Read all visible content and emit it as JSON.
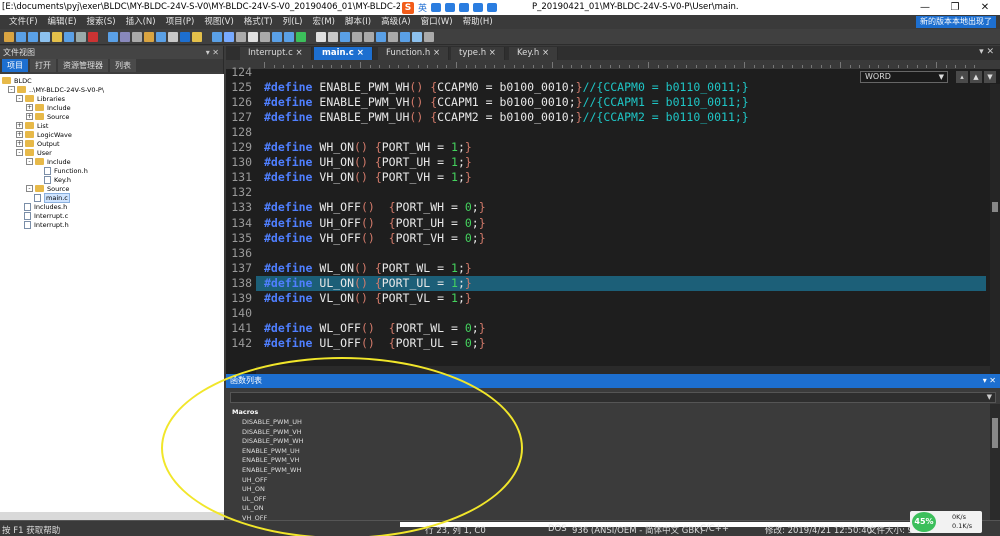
{
  "window": {
    "title": "[E:\\documents\\pyj\\exer\\BLDC\\MY-BLDC-24V-S-V0\\MY-BLDC-24V-S-V0_20190406_01\\MY-BLDC-24V-S",
    "title_tail": "P_20190421_01\\MY-BLDC-24V-S-V0-P\\User\\main.",
    "ime_label": "英",
    "minimize": "—",
    "maximize": "❐",
    "close": "✕"
  },
  "menu": {
    "items": [
      "文件(F)",
      "编辑(E)",
      "搜索(S)",
      "插入(N)",
      "项目(P)",
      "视图(V)",
      "格式(T)",
      "列(L)",
      "宏(M)",
      "脚本(I)",
      "高级(A)",
      "窗口(W)",
      "帮助(H)"
    ],
    "update_label": "新的版本本地出现了"
  },
  "left_panel": {
    "title": "文件视图",
    "controls": "▾ ✕",
    "tabs": [
      "项目",
      "打开",
      "资源管理器",
      "列表"
    ],
    "tree": {
      "root": "BLDC",
      "project": "..\\MY-BLDC-24V-S-V0-P\\",
      "nodes": [
        "Libraries",
        "Include",
        "Source",
        "List",
        "LogicWave",
        "Output",
        "User",
        "Include",
        "Function.h",
        "Key.h",
        "Source",
        "main.c",
        "Includes.h",
        "Interrupt.c",
        "Interrupt.h"
      ]
    }
  },
  "editor": {
    "tabs": [
      {
        "label": "Interrupt.c",
        "close": "×"
      },
      {
        "label": "main.c",
        "close": "×"
      },
      {
        "label": "Function.h",
        "close": "×"
      },
      {
        "label": "type.h",
        "close": "×"
      },
      {
        "label": "Key.h",
        "close": "×"
      }
    ],
    "tab_controls": "▾ ✕",
    "search_mode": "WORD",
    "search_buttons": [
      "▴",
      "▲",
      "▼"
    ],
    "line_numbers": [
      "124",
      "125",
      "126",
      "127",
      "128",
      "129",
      "130",
      "131",
      "132",
      "133",
      "134",
      "135",
      "136",
      "137",
      "138",
      "139",
      "140",
      "141",
      "142"
    ],
    "lines": [
      {
        "parts": []
      },
      {
        "parts": [
          [
            "kw",
            "#define"
          ],
          [
            "",
            " ENABLE_PWM_WH"
          ],
          [
            "br",
            "()"
          ],
          [
            "",
            " "
          ],
          [
            "br",
            "{"
          ],
          [
            "",
            "CCAPM0 = b0100_0010;"
          ],
          [
            "br",
            "}"
          ],
          [
            "cmt",
            "//{CCAPM0 = b0110_0011;}"
          ]
        ]
      },
      {
        "parts": [
          [
            "kw",
            "#define"
          ],
          [
            "",
            " ENABLE_PWM_VH"
          ],
          [
            "br",
            "()"
          ],
          [
            "",
            " "
          ],
          [
            "br",
            "{"
          ],
          [
            "",
            "CCAPM1 = b0100_0010;"
          ],
          [
            "br",
            "}"
          ],
          [
            "cmt",
            "//{CCAPM1 = b0110_0011;}"
          ]
        ]
      },
      {
        "parts": [
          [
            "kw",
            "#define"
          ],
          [
            "",
            " ENABLE_PWM_UH"
          ],
          [
            "br",
            "()"
          ],
          [
            "",
            " "
          ],
          [
            "br",
            "{"
          ],
          [
            "",
            "CCAPM2 = b0100_0010;"
          ],
          [
            "br",
            "}"
          ],
          [
            "cmt",
            "//{CCAPM2 = b0110_0011;}"
          ]
        ]
      },
      {
        "parts": []
      },
      {
        "parts": [
          [
            "kw",
            "#define"
          ],
          [
            "",
            " WH_ON"
          ],
          [
            "br",
            "()"
          ],
          [
            "",
            " "
          ],
          [
            "br",
            "{"
          ],
          [
            "",
            "PORT_WH = "
          ],
          [
            "num",
            "1"
          ],
          [
            "",
            ";"
          ],
          [
            "br",
            "}"
          ]
        ]
      },
      {
        "parts": [
          [
            "kw",
            "#define"
          ],
          [
            "",
            " UH_ON"
          ],
          [
            "br",
            "()"
          ],
          [
            "",
            " "
          ],
          [
            "br",
            "{"
          ],
          [
            "",
            "PORT_UH = "
          ],
          [
            "num",
            "1"
          ],
          [
            "",
            ";"
          ],
          [
            "br",
            "}"
          ]
        ]
      },
      {
        "parts": [
          [
            "kw",
            "#define"
          ],
          [
            "",
            " VH_ON"
          ],
          [
            "br",
            "()"
          ],
          [
            "",
            " "
          ],
          [
            "br",
            "{"
          ],
          [
            "",
            "PORT_VH = "
          ],
          [
            "num",
            "1"
          ],
          [
            "",
            ";"
          ],
          [
            "br",
            "}"
          ]
        ]
      },
      {
        "parts": []
      },
      {
        "parts": [
          [
            "kw",
            "#define"
          ],
          [
            "",
            " WH_OFF"
          ],
          [
            "br",
            "()"
          ],
          [
            "",
            "  "
          ],
          [
            "br",
            "{"
          ],
          [
            "",
            "PORT_WH = "
          ],
          [
            "num",
            "0"
          ],
          [
            "",
            ";"
          ],
          [
            "br",
            "}"
          ]
        ]
      },
      {
        "parts": [
          [
            "kw",
            "#define"
          ],
          [
            "",
            " UH_OFF"
          ],
          [
            "br",
            "()"
          ],
          [
            "",
            "  "
          ],
          [
            "br",
            "{"
          ],
          [
            "",
            "PORT_UH = "
          ],
          [
            "num",
            "0"
          ],
          [
            "",
            ";"
          ],
          [
            "br",
            "}"
          ]
        ]
      },
      {
        "parts": [
          [
            "kw",
            "#define"
          ],
          [
            "",
            " VH_OFF"
          ],
          [
            "br",
            "()"
          ],
          [
            "",
            "  "
          ],
          [
            "br",
            "{"
          ],
          [
            "",
            "PORT_VH = "
          ],
          [
            "num",
            "0"
          ],
          [
            "",
            ";"
          ],
          [
            "br",
            "}"
          ]
        ]
      },
      {
        "parts": []
      },
      {
        "parts": [
          [
            "kw",
            "#define"
          ],
          [
            "",
            " WL_ON"
          ],
          [
            "br",
            "()"
          ],
          [
            "",
            " "
          ],
          [
            "br",
            "{"
          ],
          [
            "",
            "PORT_WL = "
          ],
          [
            "num",
            "1"
          ],
          [
            "",
            ";"
          ],
          [
            "br",
            "}"
          ]
        ]
      },
      {
        "parts": [
          [
            "kw",
            "#define"
          ],
          [
            "",
            " UL_ON"
          ],
          [
            "br",
            "()"
          ],
          [
            "",
            " "
          ],
          [
            "br",
            "{"
          ],
          [
            "",
            "PORT_UL = "
          ],
          [
            "num",
            "1"
          ],
          [
            "",
            ";"
          ],
          [
            "br",
            "}"
          ]
        ]
      },
      {
        "parts": [
          [
            "kw",
            "#define"
          ],
          [
            "",
            " VL_ON"
          ],
          [
            "br",
            "()"
          ],
          [
            "",
            " "
          ],
          [
            "br",
            "{"
          ],
          [
            "",
            "PORT_VL = "
          ],
          [
            "num",
            "1"
          ],
          [
            "",
            ";"
          ],
          [
            "br",
            "}"
          ]
        ]
      },
      {
        "parts": []
      },
      {
        "parts": [
          [
            "kw",
            "#define"
          ],
          [
            "",
            " WL_OFF"
          ],
          [
            "br",
            "()"
          ],
          [
            "",
            "  "
          ],
          [
            "br",
            "{"
          ],
          [
            "",
            "PORT_WL = "
          ],
          [
            "num",
            "0"
          ],
          [
            "",
            ";"
          ],
          [
            "br",
            "}"
          ]
        ]
      },
      {
        "parts": [
          [
            "kw",
            "#define"
          ],
          [
            "",
            " UL_OFF"
          ],
          [
            "br",
            "()"
          ],
          [
            "",
            "  "
          ],
          [
            "br",
            "{"
          ],
          [
            "",
            "PORT_UL = "
          ],
          [
            "num",
            "0"
          ],
          [
            "",
            ";"
          ],
          [
            "br",
            "}"
          ]
        ]
      }
    ],
    "highlighted_line": "138"
  },
  "function_list": {
    "title": "函数列表",
    "controls": "▾ ✕",
    "group": "Macros",
    "items": [
      "DISABLE_PWM_UH",
      "DISABLE_PWM_VH",
      "DISABLE_PWM_WH",
      "ENABLE_PWM_UH",
      "ENABLE_PWM_VH",
      "ENABLE_PWM_WH",
      "UH_OFF",
      "UH_ON",
      "UL_OFF",
      "UL_ON",
      "VH_OFF"
    ]
  },
  "status": {
    "help": "按 F1 获取帮助",
    "position": "行 23, 列 1, C0",
    "line_ending": "DOS",
    "encoding": "936  (ANSI/OEM - 简体中文 GBK)",
    "language": "C/C++",
    "modified": "修改:  2019/4/21 12:50:40",
    "filesize": "文件大小:  90",
    "net_percent": "45%",
    "up_rate": "0K/s",
    "down_rate": "0.1K/s"
  },
  "colors": {
    "accent": "#1d6fd0",
    "keyword": "#4f7fff",
    "number": "#44d35e",
    "comment": "#1ec6c6",
    "bracket": "#d37a6a",
    "annotation": "#f1e62a"
  }
}
